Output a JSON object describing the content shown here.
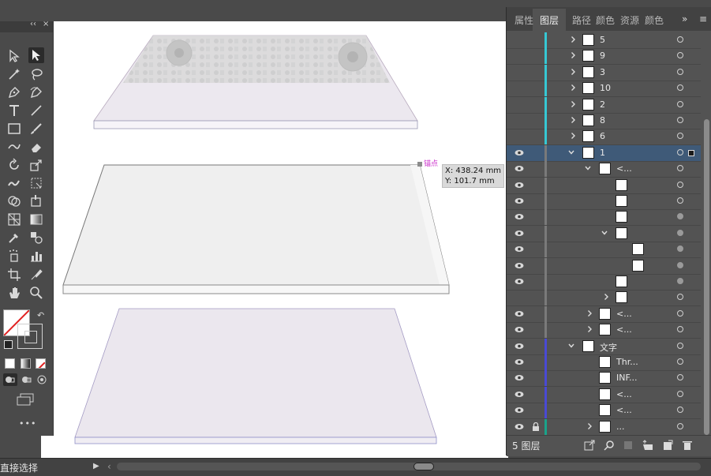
{
  "panel": {
    "tabs": [
      {
        "label": "属性"
      },
      {
        "label": "图层"
      },
      {
        "label": "路径"
      },
      {
        "label": "颜色"
      },
      {
        "label": "资源"
      },
      {
        "label": "颜色"
      }
    ],
    "expand_glyph": "»",
    "menu_glyph": "≡",
    "footer_count": "5 图层",
    "rows": [
      {
        "label": "5",
        "visible": false,
        "color": "#36c8d4",
        "chevron": "right",
        "indent": 0,
        "target": "empty"
      },
      {
        "label": "9",
        "visible": false,
        "color": "#36c8d4",
        "chevron": "right",
        "indent": 0,
        "target": "empty"
      },
      {
        "label": "3",
        "visible": false,
        "color": "#36c8d4",
        "chevron": "right",
        "indent": 0,
        "target": "empty"
      },
      {
        "label": "10",
        "visible": false,
        "color": "#36c8d4",
        "chevron": "right",
        "indent": 0,
        "target": "empty"
      },
      {
        "label": "2",
        "visible": false,
        "color": "#36c8d4",
        "chevron": "right",
        "indent": 0,
        "target": "empty"
      },
      {
        "label": "8",
        "visible": false,
        "color": "#36c8d4",
        "chevron": "right",
        "indent": 0,
        "target": "empty"
      },
      {
        "label": "6",
        "visible": false,
        "color": "#36c8d4",
        "chevron": "right",
        "indent": 0,
        "target": "empty"
      },
      {
        "label": "1",
        "visible": true,
        "color": "#7a7a7a",
        "chevron": "down",
        "indent": 0,
        "target": "empty",
        "selected": true
      },
      {
        "label": "<...",
        "visible": true,
        "color": "#7a7a7a",
        "chevron": "down",
        "indent": 1,
        "target": "empty"
      },
      {
        "label": "",
        "visible": true,
        "color": "#7a7a7a",
        "chevron": "",
        "indent": 2,
        "target": "empty"
      },
      {
        "label": "",
        "visible": true,
        "color": "#7a7a7a",
        "chevron": "",
        "indent": 2,
        "target": "empty"
      },
      {
        "label": "",
        "visible": true,
        "color": "#7a7a7a",
        "chevron": "",
        "indent": 2,
        "target": "filled"
      },
      {
        "label": "",
        "visible": true,
        "color": "#7a7a7a",
        "chevron": "down",
        "indent": 2,
        "target": "filled"
      },
      {
        "label": "",
        "visible": true,
        "color": "#7a7a7a",
        "chevron": "",
        "indent": 3,
        "target": "filled"
      },
      {
        "label": "",
        "visible": true,
        "color": "#7a7a7a",
        "chevron": "",
        "indent": 3,
        "target": "filled"
      },
      {
        "label": "",
        "visible": true,
        "color": "#7a7a7a",
        "chevron": "",
        "indent": 2,
        "target": "filled"
      },
      {
        "label": "",
        "visible": false,
        "color": "#7a7a7a",
        "chevron": "right",
        "indent": 2,
        "target": "empty"
      },
      {
        "label": "<...",
        "visible": true,
        "color": "#7a7a7a",
        "chevron": "right",
        "indent": 1,
        "target": "empty"
      },
      {
        "label": "<...",
        "visible": true,
        "color": "#7a7a7a",
        "chevron": "right",
        "indent": 1,
        "target": "empty"
      },
      {
        "label": "文字",
        "visible": true,
        "color": "#4a4ad4",
        "chevron": "down",
        "indent": 0,
        "target": "empty"
      },
      {
        "label": "Thr...",
        "visible": true,
        "color": "#4a4ad4",
        "chevron": "",
        "indent": 1,
        "target": "empty"
      },
      {
        "label": "INF...",
        "visible": true,
        "color": "#4a4ad4",
        "chevron": "",
        "indent": 1,
        "target": "empty"
      },
      {
        "label": "<...",
        "visible": true,
        "color": "#4a4ad4",
        "chevron": "",
        "indent": 1,
        "target": "empty"
      },
      {
        "label": "<...",
        "visible": true,
        "color": "#4a4ad4",
        "chevron": "",
        "indent": 1,
        "target": "empty"
      },
      {
        "label": "...",
        "visible": true,
        "locked": true,
        "color": "#1aa38a",
        "chevron": "right",
        "indent": 1,
        "target": "empty"
      }
    ]
  },
  "canvas": {
    "anchor_label": "锚点",
    "tooltip_x": "X: 438.24 mm",
    "tooltip_y": "Y: 101.7 mm"
  },
  "status": {
    "tool_name": "直接选择",
    "arrow": "▶",
    "scroll_left": "‹"
  },
  "toolbar": {
    "collapse": "‹‹",
    "close": "×",
    "more": "•••"
  }
}
